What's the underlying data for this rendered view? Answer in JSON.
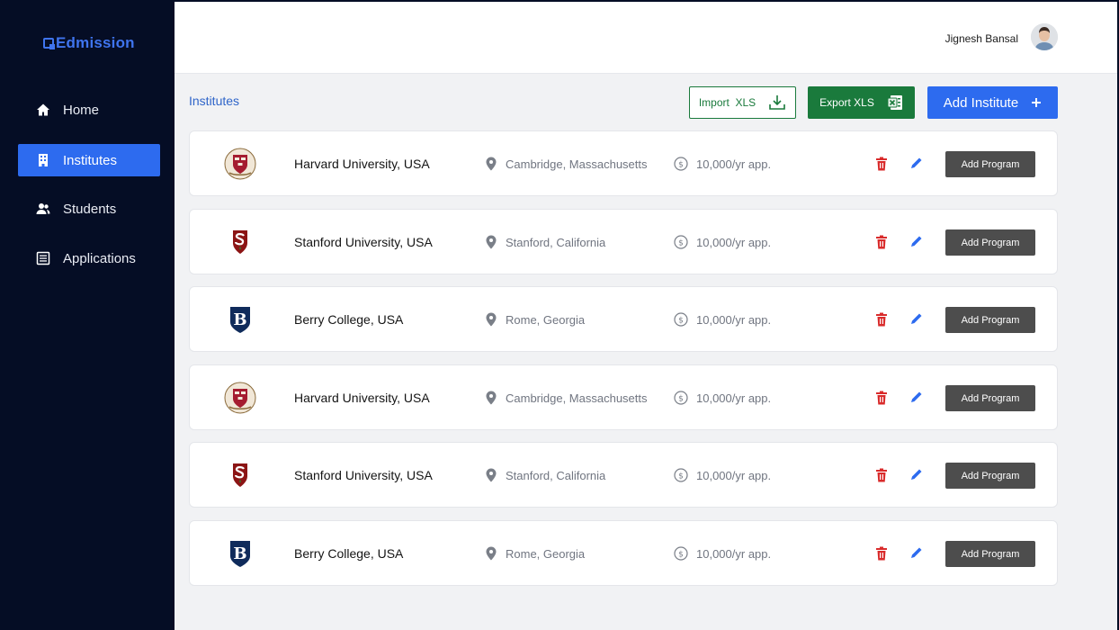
{
  "brand": {
    "name": "Edmission",
    "color": "#3f74ee"
  },
  "sidebar": {
    "items": [
      {
        "label": "Home",
        "icon": "home-icon",
        "active": false
      },
      {
        "label": "Institutes",
        "icon": "building-icon",
        "active": true
      },
      {
        "label": "Students",
        "icon": "users-icon",
        "active": false
      },
      {
        "label": "Applications",
        "icon": "list-icon",
        "active": false
      }
    ]
  },
  "header": {
    "user_name": "Jignesh Bansal",
    "avatar": "user-avatar"
  },
  "page": {
    "title": "Institutes"
  },
  "toolbar": {
    "import_label": "Import  XLS",
    "export_label": "Export XLS",
    "add_label": "Add Institute"
  },
  "institutes": [
    {
      "name": "Harvard University, USA",
      "location": "Cambridge, Massachusetts",
      "fee": "10,000/yr app.",
      "logo": "harvard-crest",
      "action": "Add Program"
    },
    {
      "name": "Stanford University, USA",
      "location": "Stanford, California",
      "fee": "10,000/yr app.",
      "logo": "stanford-crest",
      "action": "Add Program"
    },
    {
      "name": "Berry College, USA",
      "location": "Rome, Georgia",
      "fee": "10,000/yr app.",
      "logo": "berry-crest",
      "action": "Add Program"
    },
    {
      "name": "Harvard University, USA",
      "location": "Cambridge, Massachusetts",
      "fee": "10,000/yr app.",
      "logo": "harvard-crest",
      "action": "Add Program"
    },
    {
      "name": "Stanford University, USA",
      "location": "Stanford, California",
      "fee": "10,000/yr app.",
      "logo": "stanford-crest",
      "action": "Add Program"
    },
    {
      "name": "Berry College, USA",
      "location": "Rome, Georgia",
      "fee": "10,000/yr app.",
      "logo": "berry-crest",
      "action": "Add Program"
    }
  ],
  "colors": {
    "sidebar_bg": "#050d25",
    "accent": "#2d6bef",
    "excel_green": "#1a7a3c",
    "delete_red": "#d92b2b"
  }
}
